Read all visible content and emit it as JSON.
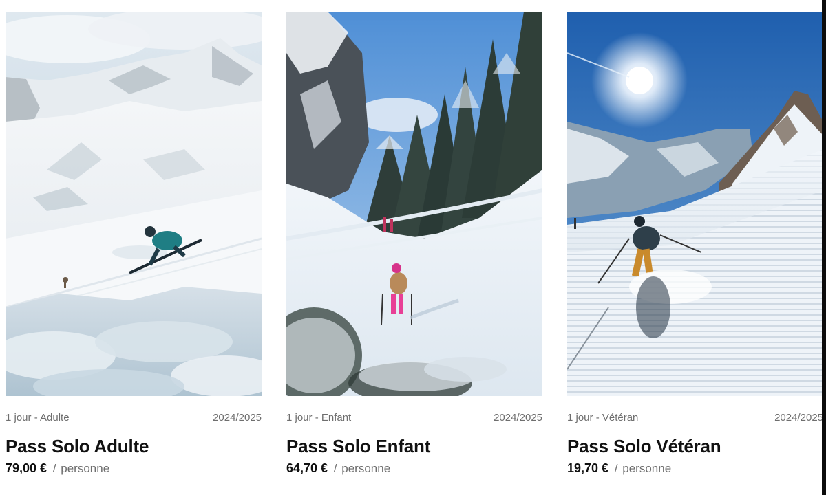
{
  "colors": {
    "text_primary": "#111111",
    "text_secondary": "#6e6e6e",
    "background": "#ffffff"
  },
  "products": [
    {
      "photo": "ski-photo-adult-carving",
      "category": "1 jour - Adulte",
      "season": "2024/2025",
      "name": "Pass Solo Adulte",
      "price": "79,00 €",
      "unit_sep": "/",
      "unit": "personne"
    },
    {
      "photo": "ski-photo-child-forest-trail",
      "category": "1 jour - Enfant",
      "season": "2024/2025",
      "name": "Pass Solo Enfant",
      "price": "64,70 €",
      "unit_sep": "/",
      "unit": "personne"
    },
    {
      "photo": "ski-photo-veteran-groomed-slope",
      "category": "1 jour - Vétéran",
      "season": "2024/2025",
      "name": "Pass Solo Vétéran",
      "price": "19,70 €",
      "unit_sep": "/",
      "unit": "personne"
    }
  ]
}
